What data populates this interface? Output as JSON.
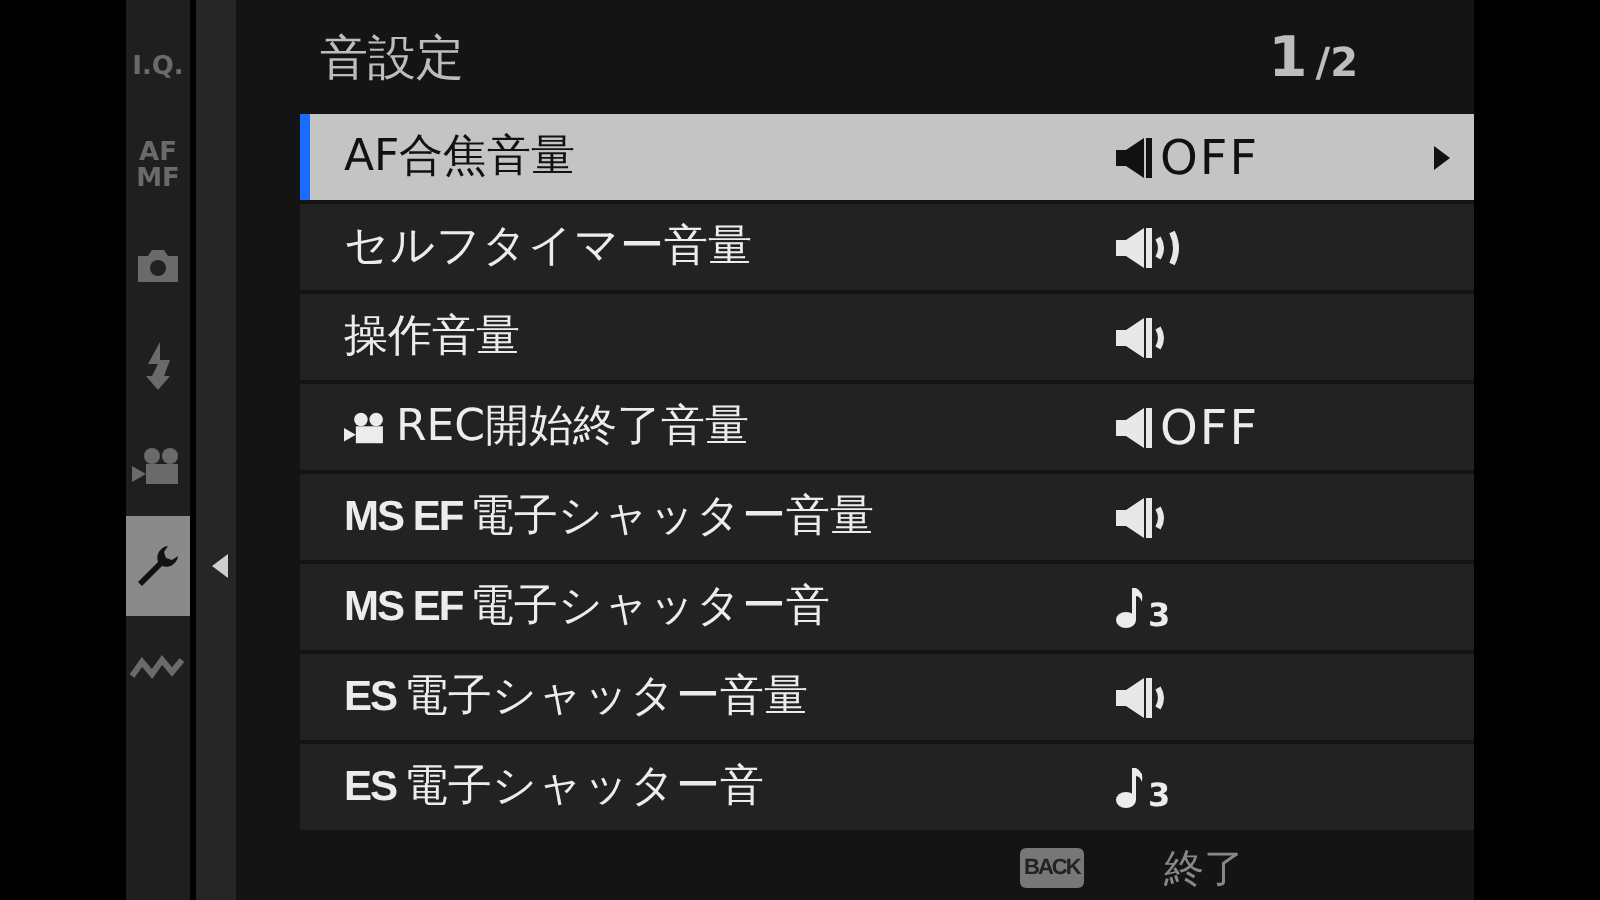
{
  "sidebar": {
    "items": [
      {
        "kind": "text",
        "label": "I.Q.",
        "selected": false
      },
      {
        "kind": "text",
        "label": "AF MF",
        "selected": false
      },
      {
        "kind": "camera",
        "selected": false
      },
      {
        "kind": "flash",
        "selected": false
      },
      {
        "kind": "movie",
        "selected": false
      },
      {
        "kind": "wrench",
        "selected": true
      },
      {
        "kind": "connection",
        "selected": false
      }
    ]
  },
  "header": {
    "title": "音設定",
    "page": "1",
    "total": "/2"
  },
  "rows": [
    {
      "label": "AF合焦音量",
      "selected": true,
      "value": {
        "kind": "mute",
        "text": "OFF"
      }
    },
    {
      "label": "セルフタイマー音量",
      "selected": false,
      "value": {
        "kind": "mid"
      }
    },
    {
      "label": "操作音量",
      "selected": false,
      "value": {
        "kind": "low"
      }
    },
    {
      "label": "REC開始終了音量",
      "movie": true,
      "selected": false,
      "value": {
        "kind": "mute",
        "text": "OFF"
      }
    },
    {
      "prefix": "MS EF",
      "label": "電子シャッター音量",
      "selected": false,
      "value": {
        "kind": "low"
      }
    },
    {
      "prefix": "MS EF",
      "label": "電子シャッター音",
      "selected": false,
      "value": {
        "kind": "tone",
        "text": "3"
      }
    },
    {
      "prefix": "ES",
      "label": "電子シャッター音量",
      "selected": false,
      "value": {
        "kind": "low"
      }
    },
    {
      "prefix": "ES",
      "label": "電子シャッター音",
      "selected": false,
      "value": {
        "kind": "tone",
        "text": "3"
      }
    }
  ],
  "footer": {
    "key": "BACK",
    "action": "終了"
  }
}
